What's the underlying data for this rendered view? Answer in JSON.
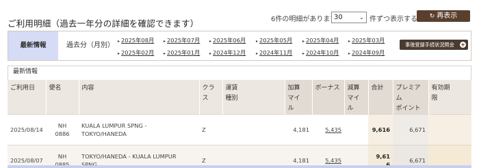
{
  "header": {
    "title": "ご利用明細（過去一年分の詳細を確認できます）",
    "count_text": "6件の明細があります",
    "per_page_value": "30",
    "per_page_suffix": "件ずつ表示する",
    "redisplay_label": "再表示"
  },
  "tabs": {
    "latest_label": "最新情報",
    "past_label": "過去分（月別）"
  },
  "months_row1": [
    "2025年08月",
    "2025年07月",
    "2025年06月",
    "2025年05月",
    "2025年04月",
    "2025年03月"
  ],
  "months_row2": [
    "2025年02月",
    "2025年01月",
    "2024年12月",
    "2024年11月",
    "2024年10月",
    "2024年09月"
  ],
  "briefing_label": "事後登録手続状況照会",
  "section_label": "最新情報",
  "table": {
    "headers": [
      "ご利用日",
      "便名",
      "内容",
      "クラス",
      "運賃\n種別",
      "加算\nマイ\nル",
      "ボーナス",
      "減算\nマイ\nル",
      "合計",
      "プレミア\nム\nポイント",
      "有効期\n限"
    ],
    "rows": [
      {
        "date": "2025/08/14",
        "flight": "NH\n0886",
        "content": "KUALA LUMPUR SPNG -\nTOKYO/HANEDA",
        "class": "Z",
        "fare": "",
        "add_miles": "4,181",
        "bonus": "5,435",
        "deduct": "",
        "total": "9,616",
        "premium": "6,671",
        "expiry": ""
      },
      {
        "date": "2025/08/07",
        "flight": "NH\n0885",
        "content": "TOKYO/HANEDA - KUALA LUMPUR\nSPNG",
        "class": "Z",
        "fare": "",
        "add_miles": "4,181",
        "bonus": "5,435",
        "deduct": "",
        "total": "9,61\n6",
        "premium": "6,671",
        "expiry": ""
      }
    ]
  },
  "colors": {
    "brown_button": "#5a3f2e",
    "active_tab": "#d7dcf6",
    "header_bg": "#ede7e1",
    "highlight_col": "#f7efe3"
  }
}
